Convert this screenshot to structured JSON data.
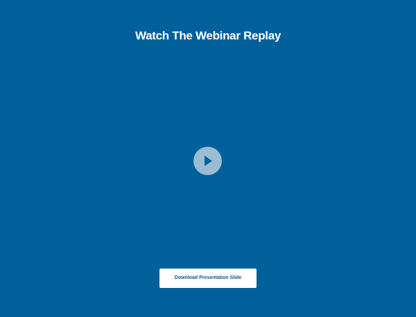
{
  "header": {
    "title": "Watch The Webinar Replay"
  },
  "video": {
    "play_icon": "play-icon"
  },
  "actions": {
    "download_label": "Download Presentation Slide"
  },
  "colors": {
    "background": "#01609a",
    "title_text": "#ffffff",
    "play_button_bg": "#d6e1e9",
    "play_icon": "#01609a",
    "button_bg": "#ffffff",
    "button_text": "#0b5a8d"
  }
}
